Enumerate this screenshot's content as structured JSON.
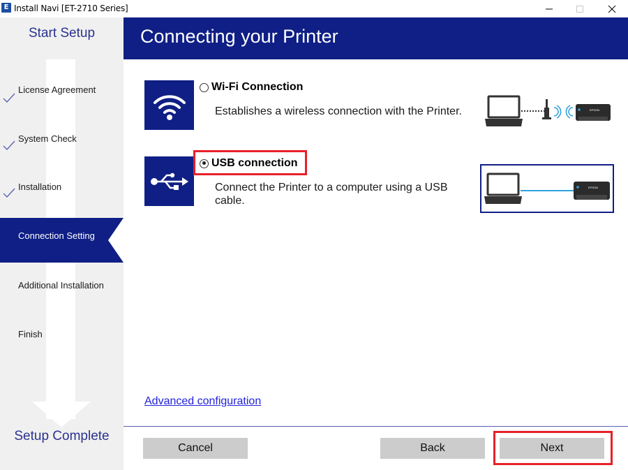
{
  "window": {
    "app_icon_letter": "E",
    "title": "Install Navi [ET-2710 Series]"
  },
  "sidebar": {
    "start_label": "Start Setup",
    "complete_label": "Setup Complete",
    "steps": [
      {
        "label": "License Agreement",
        "state": "done"
      },
      {
        "label": "System Check",
        "state": "done"
      },
      {
        "label": "Installation",
        "state": "done"
      },
      {
        "label": "Connection Setting",
        "state": "active"
      },
      {
        "label": "Additional Installation",
        "state": "pending"
      },
      {
        "label": "Finish",
        "state": "pending"
      }
    ]
  },
  "header": {
    "title": "Connecting your Printer"
  },
  "options": [
    {
      "id": "wifi",
      "icon": "wifi-icon",
      "label": "Wi-Fi Connection",
      "description": "Establishes a wireless connection with the Printer.",
      "selected": false
    },
    {
      "id": "usb",
      "icon": "usb-icon",
      "label": "USB connection",
      "description": "Connect the Printer to a computer using a USB cable.",
      "selected": true
    }
  ],
  "printer_brand": "EPSON",
  "advanced_link": "Advanced configuration",
  "buttons": {
    "cancel": "Cancel",
    "back": "Back",
    "next": "Next"
  },
  "colors": {
    "brand_blue": "#0f1f85",
    "highlight_red": "#e8202a",
    "link_blue": "#2222dd",
    "usb_cable": "#2ea3de"
  }
}
